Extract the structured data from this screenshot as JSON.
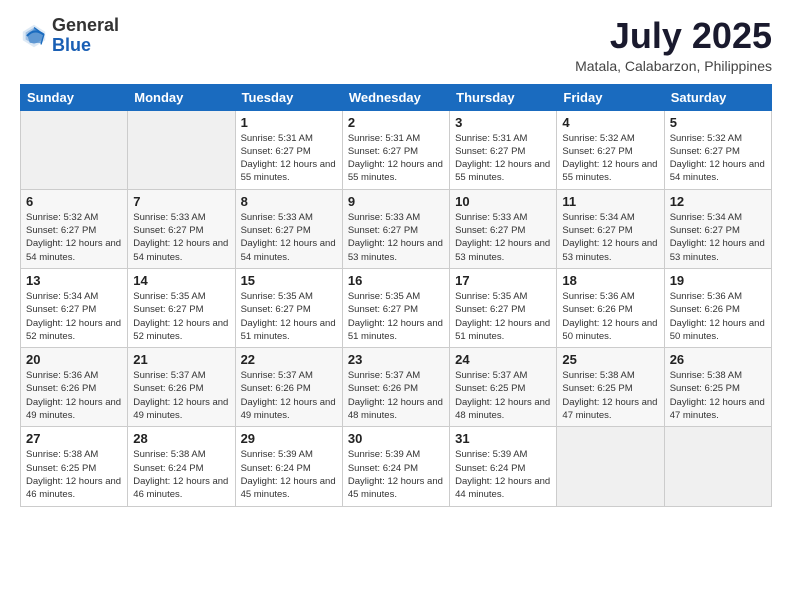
{
  "logo": {
    "text_general": "General",
    "text_blue": "Blue"
  },
  "header": {
    "month_year": "July 2025",
    "location": "Matala, Calabarzon, Philippines"
  },
  "weekdays": [
    "Sunday",
    "Monday",
    "Tuesday",
    "Wednesday",
    "Thursday",
    "Friday",
    "Saturday"
  ],
  "weeks": [
    [
      {
        "day": "",
        "sunrise": "",
        "sunset": "",
        "daylight": ""
      },
      {
        "day": "",
        "sunrise": "",
        "sunset": "",
        "daylight": ""
      },
      {
        "day": "1",
        "sunrise": "Sunrise: 5:31 AM",
        "sunset": "Sunset: 6:27 PM",
        "daylight": "Daylight: 12 hours and 55 minutes."
      },
      {
        "day": "2",
        "sunrise": "Sunrise: 5:31 AM",
        "sunset": "Sunset: 6:27 PM",
        "daylight": "Daylight: 12 hours and 55 minutes."
      },
      {
        "day": "3",
        "sunrise": "Sunrise: 5:31 AM",
        "sunset": "Sunset: 6:27 PM",
        "daylight": "Daylight: 12 hours and 55 minutes."
      },
      {
        "day": "4",
        "sunrise": "Sunrise: 5:32 AM",
        "sunset": "Sunset: 6:27 PM",
        "daylight": "Daylight: 12 hours and 55 minutes."
      },
      {
        "day": "5",
        "sunrise": "Sunrise: 5:32 AM",
        "sunset": "Sunset: 6:27 PM",
        "daylight": "Daylight: 12 hours and 54 minutes."
      }
    ],
    [
      {
        "day": "6",
        "sunrise": "Sunrise: 5:32 AM",
        "sunset": "Sunset: 6:27 PM",
        "daylight": "Daylight: 12 hours and 54 minutes."
      },
      {
        "day": "7",
        "sunrise": "Sunrise: 5:33 AM",
        "sunset": "Sunset: 6:27 PM",
        "daylight": "Daylight: 12 hours and 54 minutes."
      },
      {
        "day": "8",
        "sunrise": "Sunrise: 5:33 AM",
        "sunset": "Sunset: 6:27 PM",
        "daylight": "Daylight: 12 hours and 54 minutes."
      },
      {
        "day": "9",
        "sunrise": "Sunrise: 5:33 AM",
        "sunset": "Sunset: 6:27 PM",
        "daylight": "Daylight: 12 hours and 53 minutes."
      },
      {
        "day": "10",
        "sunrise": "Sunrise: 5:33 AM",
        "sunset": "Sunset: 6:27 PM",
        "daylight": "Daylight: 12 hours and 53 minutes."
      },
      {
        "day": "11",
        "sunrise": "Sunrise: 5:34 AM",
        "sunset": "Sunset: 6:27 PM",
        "daylight": "Daylight: 12 hours and 53 minutes."
      },
      {
        "day": "12",
        "sunrise": "Sunrise: 5:34 AM",
        "sunset": "Sunset: 6:27 PM",
        "daylight": "Daylight: 12 hours and 53 minutes."
      }
    ],
    [
      {
        "day": "13",
        "sunrise": "Sunrise: 5:34 AM",
        "sunset": "Sunset: 6:27 PM",
        "daylight": "Daylight: 12 hours and 52 minutes."
      },
      {
        "day": "14",
        "sunrise": "Sunrise: 5:35 AM",
        "sunset": "Sunset: 6:27 PM",
        "daylight": "Daylight: 12 hours and 52 minutes."
      },
      {
        "day": "15",
        "sunrise": "Sunrise: 5:35 AM",
        "sunset": "Sunset: 6:27 PM",
        "daylight": "Daylight: 12 hours and 51 minutes."
      },
      {
        "day": "16",
        "sunrise": "Sunrise: 5:35 AM",
        "sunset": "Sunset: 6:27 PM",
        "daylight": "Daylight: 12 hours and 51 minutes."
      },
      {
        "day": "17",
        "sunrise": "Sunrise: 5:35 AM",
        "sunset": "Sunset: 6:27 PM",
        "daylight": "Daylight: 12 hours and 51 minutes."
      },
      {
        "day": "18",
        "sunrise": "Sunrise: 5:36 AM",
        "sunset": "Sunset: 6:26 PM",
        "daylight": "Daylight: 12 hours and 50 minutes."
      },
      {
        "day": "19",
        "sunrise": "Sunrise: 5:36 AM",
        "sunset": "Sunset: 6:26 PM",
        "daylight": "Daylight: 12 hours and 50 minutes."
      }
    ],
    [
      {
        "day": "20",
        "sunrise": "Sunrise: 5:36 AM",
        "sunset": "Sunset: 6:26 PM",
        "daylight": "Daylight: 12 hours and 49 minutes."
      },
      {
        "day": "21",
        "sunrise": "Sunrise: 5:37 AM",
        "sunset": "Sunset: 6:26 PM",
        "daylight": "Daylight: 12 hours and 49 minutes."
      },
      {
        "day": "22",
        "sunrise": "Sunrise: 5:37 AM",
        "sunset": "Sunset: 6:26 PM",
        "daylight": "Daylight: 12 hours and 49 minutes."
      },
      {
        "day": "23",
        "sunrise": "Sunrise: 5:37 AM",
        "sunset": "Sunset: 6:26 PM",
        "daylight": "Daylight: 12 hours and 48 minutes."
      },
      {
        "day": "24",
        "sunrise": "Sunrise: 5:37 AM",
        "sunset": "Sunset: 6:25 PM",
        "daylight": "Daylight: 12 hours and 48 minutes."
      },
      {
        "day": "25",
        "sunrise": "Sunrise: 5:38 AM",
        "sunset": "Sunset: 6:25 PM",
        "daylight": "Daylight: 12 hours and 47 minutes."
      },
      {
        "day": "26",
        "sunrise": "Sunrise: 5:38 AM",
        "sunset": "Sunset: 6:25 PM",
        "daylight": "Daylight: 12 hours and 47 minutes."
      }
    ],
    [
      {
        "day": "27",
        "sunrise": "Sunrise: 5:38 AM",
        "sunset": "Sunset: 6:25 PM",
        "daylight": "Daylight: 12 hours and 46 minutes."
      },
      {
        "day": "28",
        "sunrise": "Sunrise: 5:38 AM",
        "sunset": "Sunset: 6:24 PM",
        "daylight": "Daylight: 12 hours and 46 minutes."
      },
      {
        "day": "29",
        "sunrise": "Sunrise: 5:39 AM",
        "sunset": "Sunset: 6:24 PM",
        "daylight": "Daylight: 12 hours and 45 minutes."
      },
      {
        "day": "30",
        "sunrise": "Sunrise: 5:39 AM",
        "sunset": "Sunset: 6:24 PM",
        "daylight": "Daylight: 12 hours and 45 minutes."
      },
      {
        "day": "31",
        "sunrise": "Sunrise: 5:39 AM",
        "sunset": "Sunset: 6:24 PM",
        "daylight": "Daylight: 12 hours and 44 minutes."
      },
      {
        "day": "",
        "sunrise": "",
        "sunset": "",
        "daylight": ""
      },
      {
        "day": "",
        "sunrise": "",
        "sunset": "",
        "daylight": ""
      }
    ]
  ]
}
